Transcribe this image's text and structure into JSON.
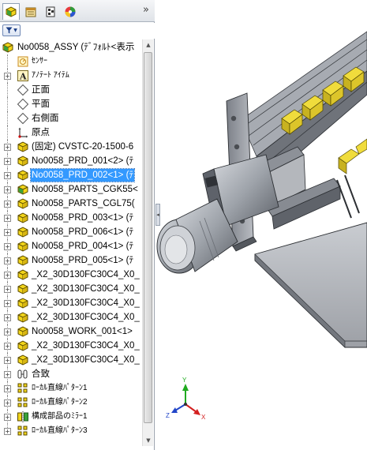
{
  "tabs": [
    {
      "name": "feature-manager",
      "icon": "feature-tree-icon"
    },
    {
      "name": "property-manager",
      "icon": "property-manager-icon"
    },
    {
      "name": "configuration-manager",
      "icon": "configuration-manager-icon"
    },
    {
      "name": "display-manager",
      "icon": "display-manager-icon"
    }
  ],
  "more_tabs_glyph": "»",
  "filter_glyph": "▼",
  "tree": [
    {
      "label": "No0058_ASSY (ﾃﾞﾌｫﾙﾄ<表示",
      "icon": "assembly-icon",
      "expand": ""
    },
    {
      "label": "ｾﾝｻｰ",
      "icon": "sensor-icon",
      "expand": ""
    },
    {
      "label": "ｱﾉﾃｰﾄ ｱｲﾃﾑ",
      "icon": "annotation-icon",
      "expand": "+"
    },
    {
      "label": "正面",
      "icon": "plane-icon",
      "expand": ""
    },
    {
      "label": "平面",
      "icon": "plane-icon",
      "expand": ""
    },
    {
      "label": "右側面",
      "icon": "plane-icon",
      "expand": ""
    },
    {
      "label": "原点",
      "icon": "origin-icon",
      "expand": ""
    },
    {
      "label": "(固定) CVSTC-20-1500-6",
      "icon": "part-icon",
      "expand": "+"
    },
    {
      "label": "No0058_PRD_001<2> (ﾃ",
      "icon": "part-icon",
      "expand": "+"
    },
    {
      "label": "No0058_PRD_002<1> (ﾃ",
      "icon": "part-icon",
      "expand": "+",
      "selected": true
    },
    {
      "label": "No0058_PARTS_CGK55<",
      "icon": "subassembly-icon",
      "expand": "+"
    },
    {
      "label": "No0058_PARTS_CGL75(",
      "icon": "part-icon",
      "expand": "+"
    },
    {
      "label": "No0058_PRD_003<1> (ﾃ",
      "icon": "part-icon",
      "expand": "+"
    },
    {
      "label": "No0058_PRD_006<1> (ﾃ",
      "icon": "part-icon",
      "expand": "+"
    },
    {
      "label": "No0058_PRD_004<1> (ﾃ",
      "icon": "part-icon",
      "expand": "+"
    },
    {
      "label": "No0058_PRD_005<1> (ﾃ",
      "icon": "part-icon",
      "expand": "+"
    },
    {
      "label": "_X2_30D130FC30C4_X0_",
      "icon": "part-icon",
      "expand": "+"
    },
    {
      "label": "_X2_30D130FC30C4_X0_",
      "icon": "part-icon",
      "expand": "+"
    },
    {
      "label": "_X2_30D130FC30C4_X0_",
      "icon": "part-icon",
      "expand": "+"
    },
    {
      "label": "_X2_30D130FC30C4_X0_",
      "icon": "part-icon",
      "expand": "+"
    },
    {
      "label": "No0058_WORK_001<1>",
      "icon": "part-icon",
      "expand": "+"
    },
    {
      "label": "_X2_30D130FC30C4_X0_",
      "icon": "part-icon",
      "expand": "+"
    },
    {
      "label": "_X2_30D130FC30C4_X0_",
      "icon": "part-icon",
      "expand": "+"
    },
    {
      "label": "合致",
      "icon": "mates-icon",
      "expand": "+"
    },
    {
      "label": "ﾛｰｶﾙ直線ﾊﾟﾀｰﾝ1",
      "icon": "linear-pattern-icon",
      "expand": "+"
    },
    {
      "label": "ﾛｰｶﾙ直線ﾊﾟﾀｰﾝ2",
      "icon": "linear-pattern-icon",
      "expand": "+"
    },
    {
      "label": "構成部品のﾐﾗｰ1",
      "icon": "mirror-component-icon",
      "expand": "+"
    },
    {
      "label": "ﾛｰｶﾙ直線ﾊﾟﾀｰﾝ3",
      "icon": "linear-pattern-icon",
      "expand": "+"
    }
  ],
  "triad": {
    "x": "X",
    "y": "Y",
    "z": "Z"
  },
  "colors": {
    "selection": "#3399ff",
    "part_yellow": "#f0dc3c",
    "triad_x": "#d42020",
    "triad_y": "#1faa1f",
    "triad_z": "#2246c8"
  }
}
